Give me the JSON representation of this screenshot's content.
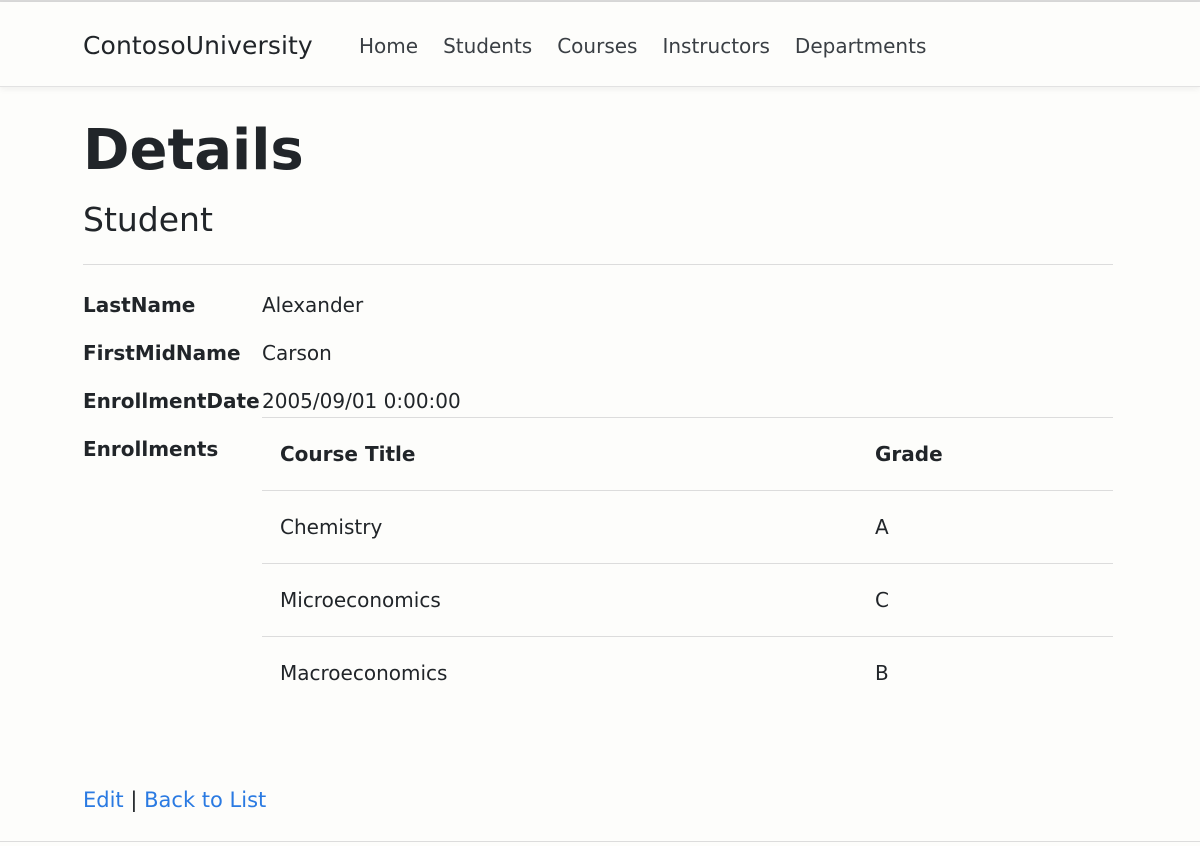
{
  "navbar": {
    "brand": "ContosoUniversity",
    "links": [
      "Home",
      "Students",
      "Courses",
      "Instructors",
      "Departments"
    ]
  },
  "page": {
    "title": "Details",
    "subtitle": "Student"
  },
  "details": {
    "last_name_label": "LastName",
    "last_name_value": "Alexander",
    "first_mid_name_label": "FirstMidName",
    "first_mid_name_value": "Carson",
    "enrollment_date_label": "EnrollmentDate",
    "enrollment_date_value": "2005/09/01 0:00:00",
    "enrollments_label": "Enrollments"
  },
  "enrollments": {
    "headers": [
      "Course Title",
      "Grade"
    ],
    "rows": [
      [
        "Chemistry",
        "A"
      ],
      [
        "Microeconomics",
        "C"
      ],
      [
        "Macroeconomics",
        "B"
      ]
    ]
  },
  "actions": {
    "edit": "Edit",
    "separator": "|",
    "back": "Back to List"
  },
  "colors": {
    "link": "#2a7ae2",
    "text": "#212529",
    "background": "#fdfdfb"
  }
}
